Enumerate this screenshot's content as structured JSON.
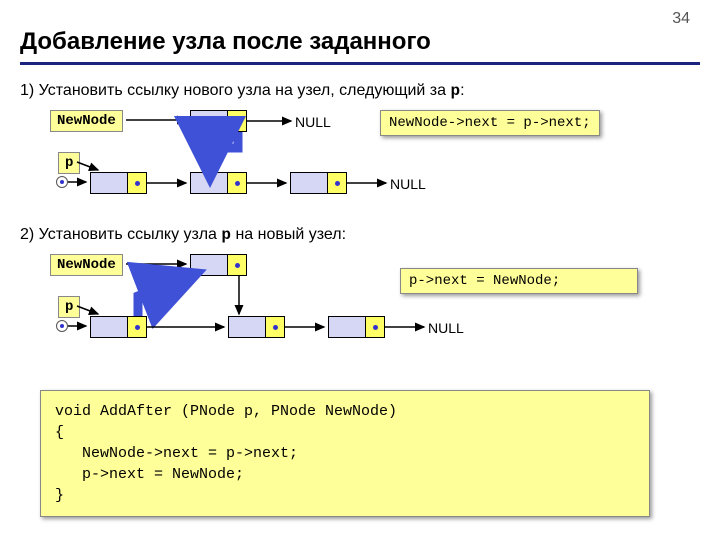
{
  "page_number": "34",
  "title": "Добавление узла после заданного",
  "step1": {
    "prefix": "1) Установить ссылку нового узла на узел, следующий за ",
    "var": "p",
    "suffix": ":"
  },
  "step2": {
    "prefix": "2) Установить ссылку узла ",
    "var": "p",
    "suffix": " на новый узел:"
  },
  "labels": {
    "newNode": "NewNode",
    "p": "p",
    "null": "NULL"
  },
  "code1": "NewNode->next = p->next;",
  "code2": "p->next = NewNode;",
  "func": "void AddAfter (PNode p, PNode NewNode)\n{\n   NewNode->next = p->next;\n   p->next = NewNode;\n}"
}
